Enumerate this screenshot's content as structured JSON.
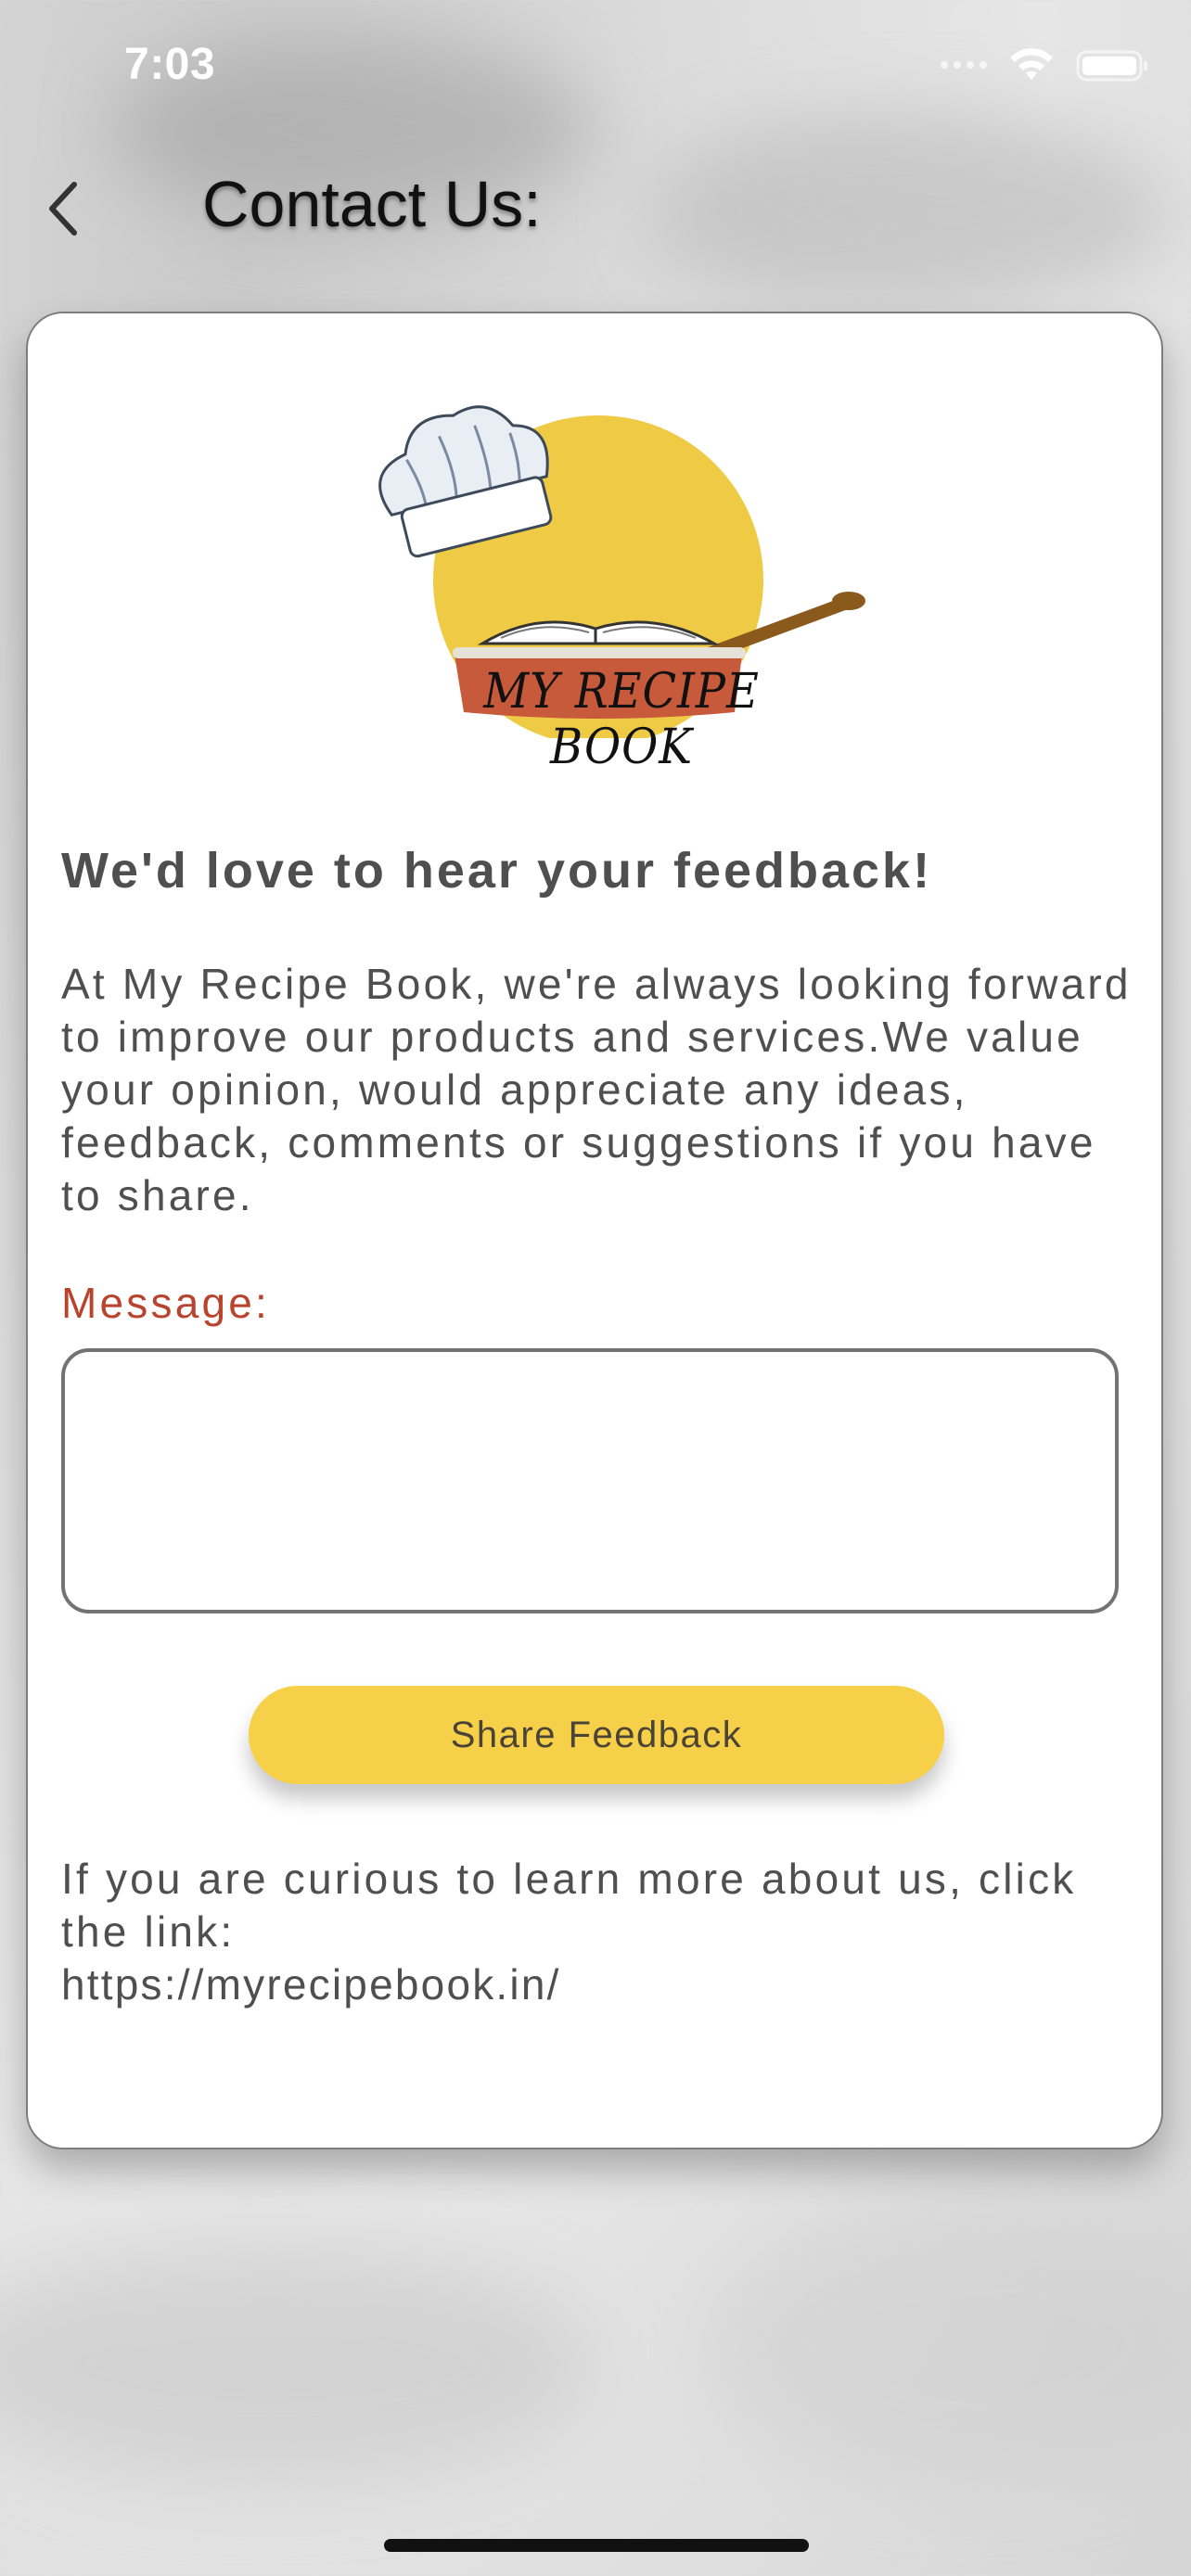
{
  "status_bar": {
    "time": "7:03",
    "wifi_icon": "wifi-icon",
    "battery_icon": "battery-icon"
  },
  "header": {
    "back_icon": "chevron-left-icon",
    "title": "Contact Us:"
  },
  "logo": {
    "text": "MY RECIPE BOOK",
    "colors": {
      "circle": "#efcb45",
      "pan": "#c85a3c",
      "handle": "#8a5a1c"
    }
  },
  "feedback": {
    "heading": "We'd love to hear your feedback!",
    "intro": "At My Recipe Book, we're always looking forward to improve our products and services.We value your opinion, would appreciate any ideas, feedback, comments or suggestions if you have to share.",
    "message_label": "Message:",
    "message_value": "",
    "message_placeholder": "",
    "share_button_label": "Share Feedback"
  },
  "about": {
    "curious_text": "If you are curious to learn more about us, click the link:",
    "link": "https://myrecipebook.in/"
  },
  "colors": {
    "accent_button": "#f6d048",
    "label_red": "#b9442e",
    "body_text": "#4f4f4f"
  }
}
